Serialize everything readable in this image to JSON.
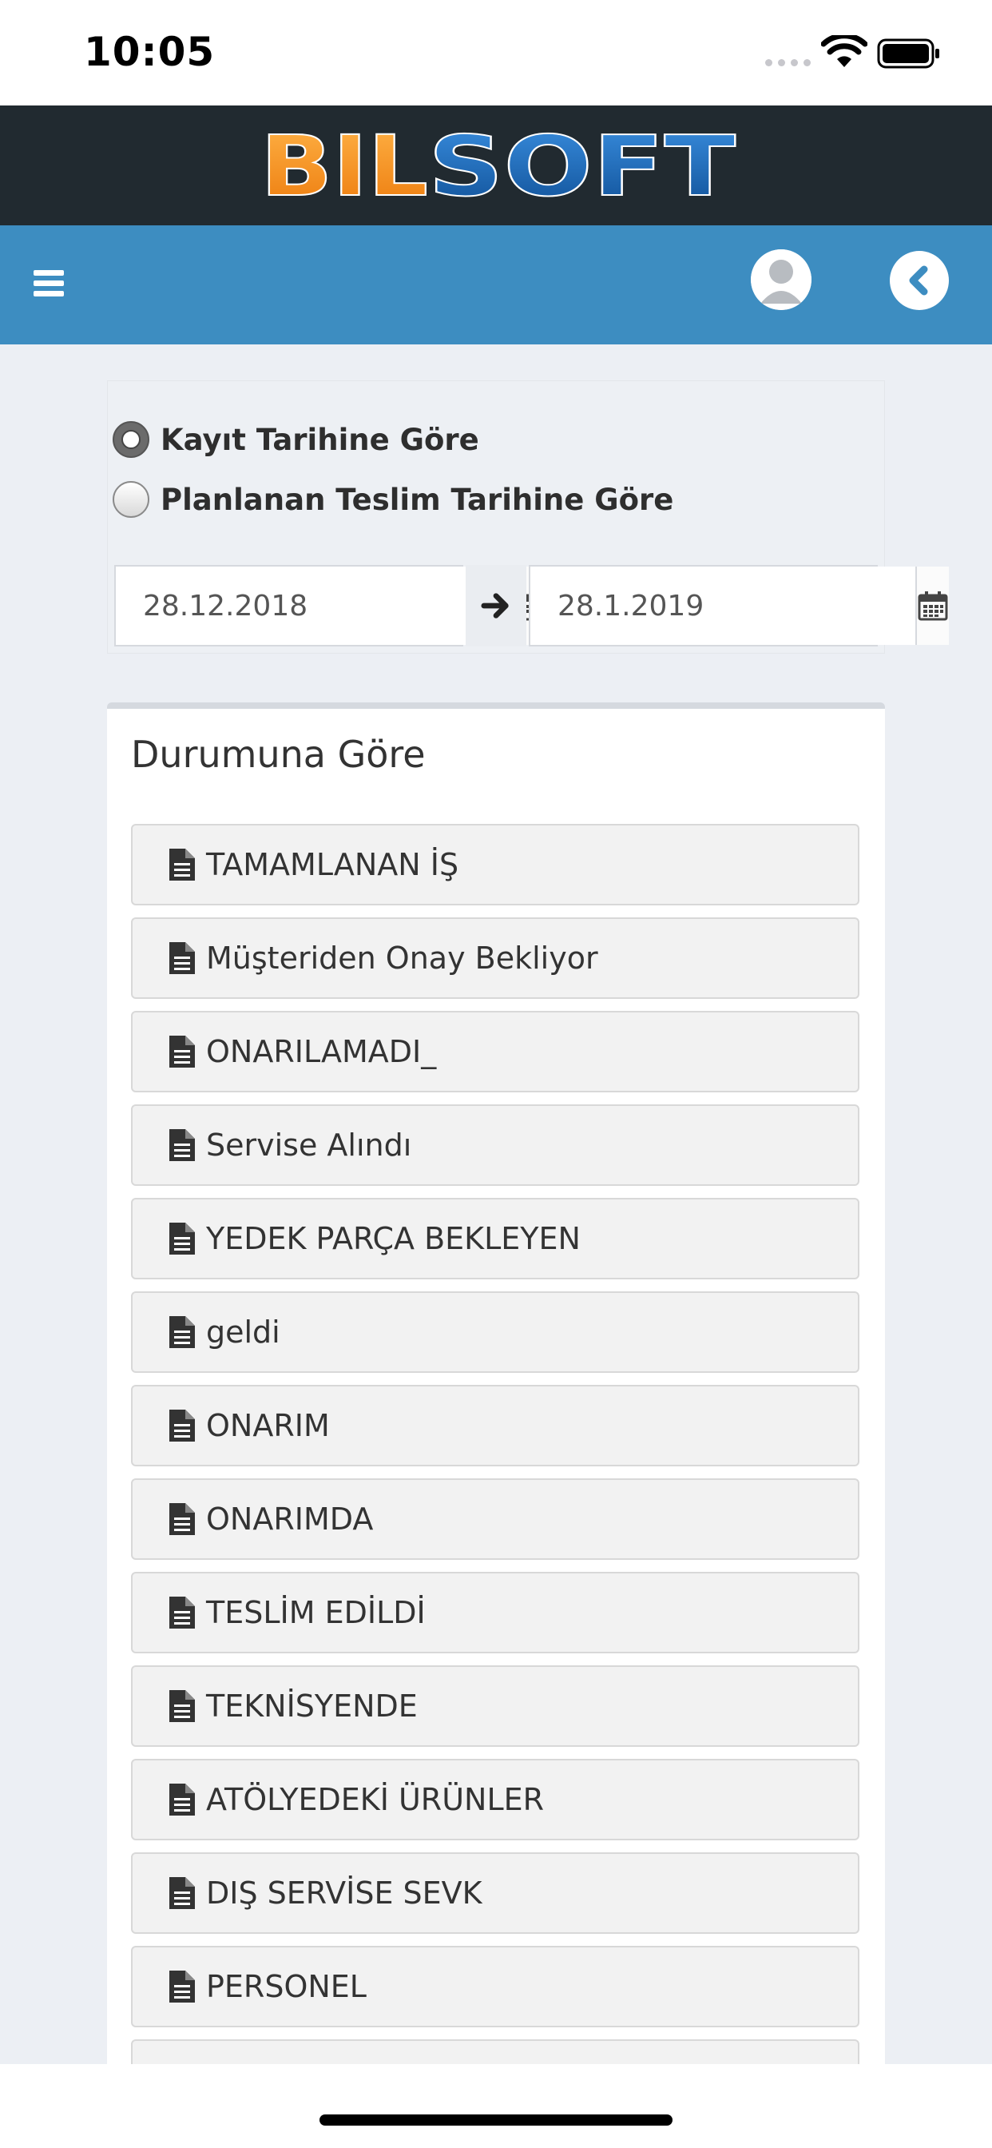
{
  "status_bar": {
    "time": "10:05"
  },
  "brand": {
    "logo_text_orange": "BIL",
    "logo_text_blue": "SOFT",
    "colors": {
      "orange": "#f7931e",
      "blue": "#1c6db3",
      "header_bg": "#212a30",
      "nav_bg": "#3d8dc1"
    }
  },
  "nav": {
    "menu_icon": "hamburger-icon",
    "avatar_icon": "user-avatar-icon",
    "back_icon": "chevron-left-icon"
  },
  "filter": {
    "options": [
      {
        "label": "Kayıt Tarihine Göre",
        "checked": true
      },
      {
        "label": "Planlanan Teslim Tarihine Göre",
        "checked": false
      }
    ],
    "start_date": "28.12.2018",
    "end_date": "28.1.2019",
    "calendar_icon": "calendar-icon",
    "range_icon": "arrow-right-icon"
  },
  "status_section": {
    "title": "Durumuna Göre",
    "item_icon": "document-icon",
    "items": [
      "TAMAMLANAN İŞ",
      "Müşteriden Onay Bekliyor",
      "ONARILAMADI_",
      "Servise Alındı",
      "YEDEK PARÇA BEKLEYEN",
      "geldi",
      "ONARIM",
      "ONARIMDA",
      "TESLİM EDİLDİ",
      "TEKNİSYENDE",
      "ATÖLYEDEKİ ÜRÜNLER",
      "DIŞ SERVİSE SEVK",
      "PERSONEL",
      ""
    ]
  }
}
